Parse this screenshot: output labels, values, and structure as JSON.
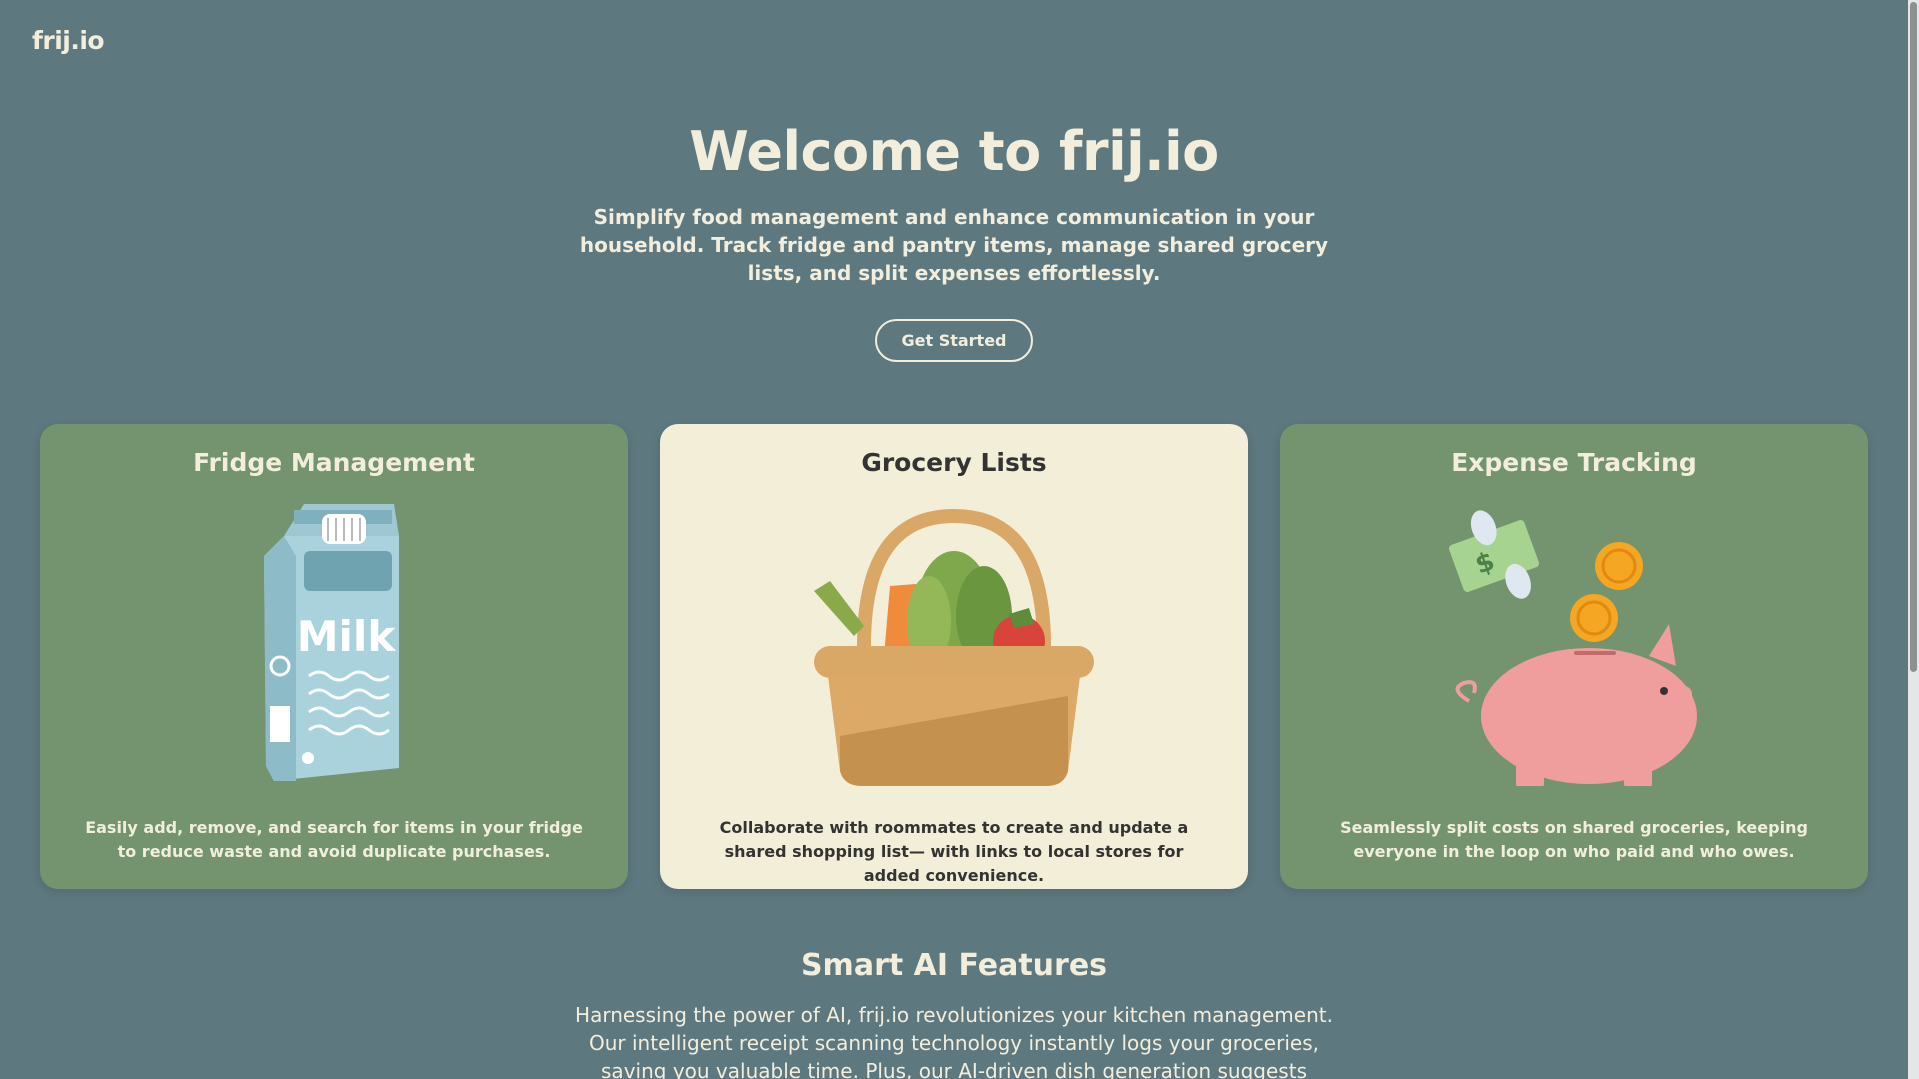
{
  "logo": "frij.io",
  "hero": {
    "title": "Welcome to frij.io",
    "subtitle": "Simplify food management and enhance communication in your household. Track fridge and pantry items, manage shared grocery lists, and split expenses effortlessly.",
    "cta": "Get Started"
  },
  "cards": [
    {
      "title": "Fridge Management",
      "text": "Easily add, remove, and search for items in your fridge to reduce waste and avoid duplicate purchases.",
      "icon": "milk-carton-icon",
      "milk_label": "Milk"
    },
    {
      "title": "Grocery Lists",
      "text": "Collaborate with roommates to create and update a shared shopping list— with links to local stores for added convenience.",
      "icon": "grocery-basket-icon"
    },
    {
      "title": "Expense Tracking",
      "text": "Seamlessly split costs on shared groceries, keeping everyone in the loop on who paid and who owes.",
      "icon": "piggy-bank-icon"
    }
  ],
  "ai": {
    "title": "Smart AI Features",
    "text": "Harnessing the power of AI, frij.io revolutionizes your kitchen management. Our intelligent receipt scanning technology instantly logs your groceries, saving you valuable time. Plus, our AI-driven dish generation suggests creative meal ideas"
  },
  "colors": {
    "background": "#5e7880",
    "card_green": "#73946f",
    "card_cream": "#f3eed8",
    "text_light": "#f3eedb"
  }
}
